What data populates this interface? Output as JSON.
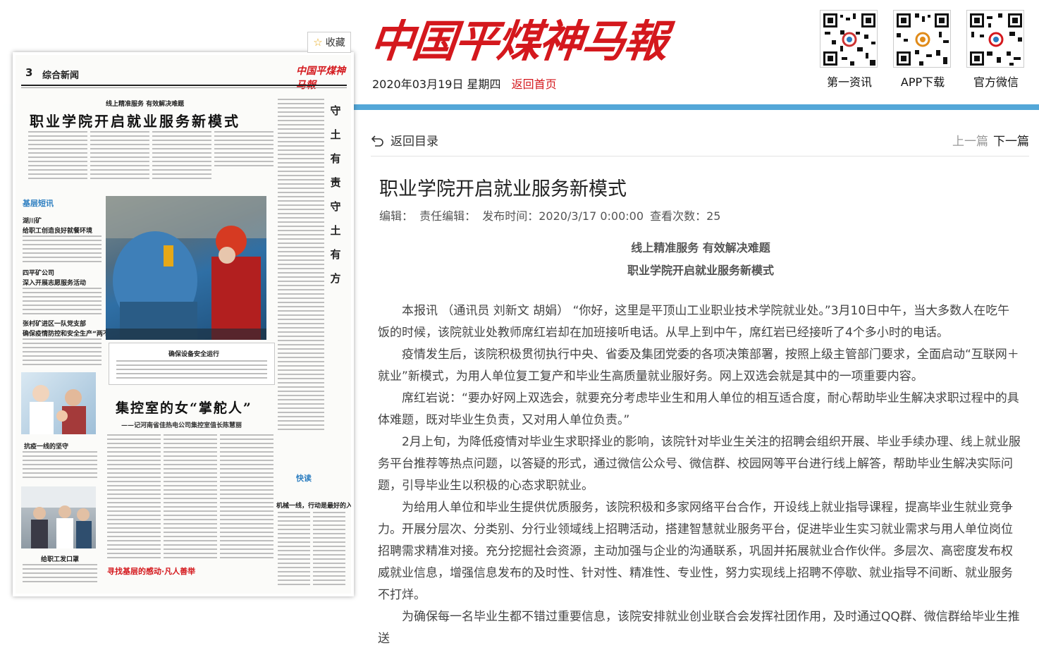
{
  "header": {
    "masthead": "中国平煤神马報",
    "date": "2020年03月19日 星期四",
    "home_link": "返回首页",
    "qr_codes": [
      {
        "label": "第一资讯",
        "icon": "qr-code-icon"
      },
      {
        "label": "APP下载",
        "icon": "qr-code-icon"
      },
      {
        "label": "官方微信",
        "icon": "qr-code-icon"
      }
    ]
  },
  "paper": {
    "favorite_label": "收藏",
    "page_number": "3",
    "page_section": "综合新闻",
    "logo": "中国平煤神马報",
    "lead_sub": "线上精准服务  有效解决难题",
    "lead_headline": "职业学院开启就业服务新模式",
    "side_column": [
      "守",
      "土",
      "有",
      "责",
      "守",
      "土",
      "有",
      "方"
    ],
    "section_tag": "基层短讯",
    "short_news": [
      {
        "org": "湖川矿",
        "title": "给职工创造良好就餐环境"
      },
      {
        "org": "四平矿公司",
        "title": "深入开展志愿服务活动"
      },
      {
        "org": "张村矿进区一队党支部",
        "title": "确保疫情防控和安全生产“两不误”"
      }
    ],
    "photo_caption_title": "确保设备安全运行",
    "feature_headline": "集控室的女“掌舵人”",
    "feature_sub": "——记河南省佳热电公司集控室值长陈慧丽",
    "photo_label_1": "抗疫一线的坚守",
    "photo_label_2": "给职工发口罩",
    "express_tag": "快读",
    "express_headline": "机械一线，行动是最好的入党誓言",
    "footer_banner": "寻找基层的感动·凡人善举"
  },
  "toolbar": {
    "back_label": "返回目录",
    "prev_label": "上一篇",
    "next_label": "下一篇"
  },
  "article": {
    "title": "职业学院开启就业服务新模式",
    "meta_editor": "编辑：",
    "meta_resp_editor": "责任编辑：",
    "meta_published": "发布时间：2020/3/17 0:00:00",
    "meta_views": "查看次数：25",
    "lead_sub": "线上精准服务  有效解决难题",
    "lead_title": "职业学院开启就业服务新模式",
    "paragraphs": [
      "本报讯 （通讯员 刘新文 胡娟） “你好，这里是平顶山工业职业技术学院就业处。”3月10日中午，当大多数人在吃午饭的时候，该院就业处教师席红岩却在加班接听电话。从早上到中午，席红岩已经接听了4个多小时的电话。",
      "疫情发生后，该院积极贯彻执行中央、省委及集团党委的各项决策部署，按照上级主管部门要求，全面启动“互联网＋就业”新模式，为用人单位复工复产和毕业生高质量就业服好务。网上双选会就是其中的一项重要内容。",
      "席红岩说：“要办好网上双选会，就要充分考虑毕业生和用人单位的相互适合度，耐心帮助毕业生解决求职过程中的具体难题，既对毕业生负责，又对用人单位负责。”",
      "2月上旬，为降低疫情对毕业生求职择业的影响，该院针对毕业生关注的招聘会组织开展、毕业手续办理、线上就业服务平台推荐等热点问题，以答疑的形式，通过微信公众号、微信群、校园网等平台进行线上解答，帮助毕业生解决实际问题，引导毕业生以积极的心态求职就业。",
      "为给用人单位和毕业生提供优质服务，该院积极和多家网络平台合作，开设线上就业指导课程，提高毕业生就业竞争力。开展分层次、分类别、分行业领域线上招聘活动，搭建智慧就业服务平台，促进毕业生实习就业需求与用人单位岗位招聘需求精准对接。充分挖掘社会资源，主动加强与企业的沟通联系，巩固并拓展就业合作伙伴。多层次、高密度发布权威就业信息，增强信息发布的及时性、针对性、精准性、专业性，努力实现线上招聘不停歇、就业指导不间断、就业服务不打烊。",
      "为确保每一名毕业生都不错过重要信息，该院安排就业创业联合会发挥社团作用，及时通过QQ群、微信群给毕业生推送"
    ]
  },
  "colors": {
    "brand_red": "#d4181d",
    "accent_blue": "#53a7d8"
  }
}
